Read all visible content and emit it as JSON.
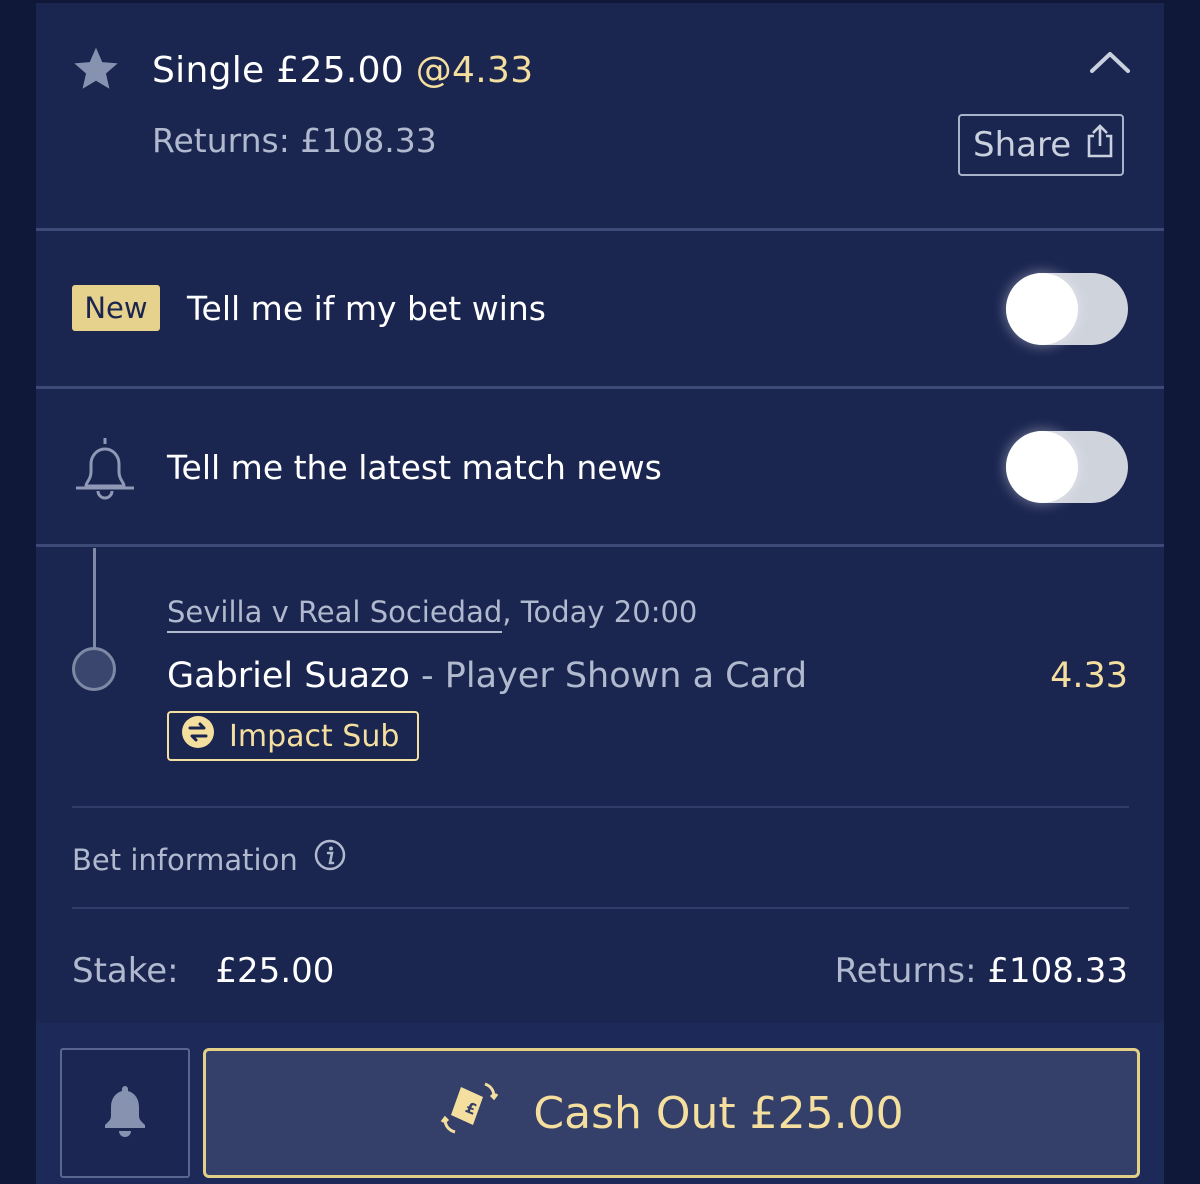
{
  "header": {
    "bet_type": "Single",
    "stake": "£25.00",
    "odds": "@4.33",
    "returns_label": "Returns:",
    "returns_value": "£108.33",
    "share_label": "Share"
  },
  "notifications": {
    "new_badge": "New",
    "bet_wins_label": "Tell me if my bet wins",
    "bet_wins_enabled": false,
    "match_news_label": "Tell me the latest match news",
    "match_news_enabled": false
  },
  "selection": {
    "event": "Sevilla v Real Sociedad",
    "event_time": ", Today 20:00",
    "player": "Gabriel Suazo",
    "market": " - Player Shown a Card",
    "odds": "4.33",
    "impact_label": "Impact Sub"
  },
  "bet_info": {
    "label": "Bet information"
  },
  "summary": {
    "stake_label": "Stake:",
    "stake_value": "£25.00",
    "returns_label": "Returns:",
    "returns_value": "£108.33"
  },
  "footer": {
    "cashout_label": "Cash Out £25.00"
  },
  "colors": {
    "background": "#1a2550",
    "accent_gold": "#f5df9e",
    "muted_text": "#b0b9cd"
  }
}
